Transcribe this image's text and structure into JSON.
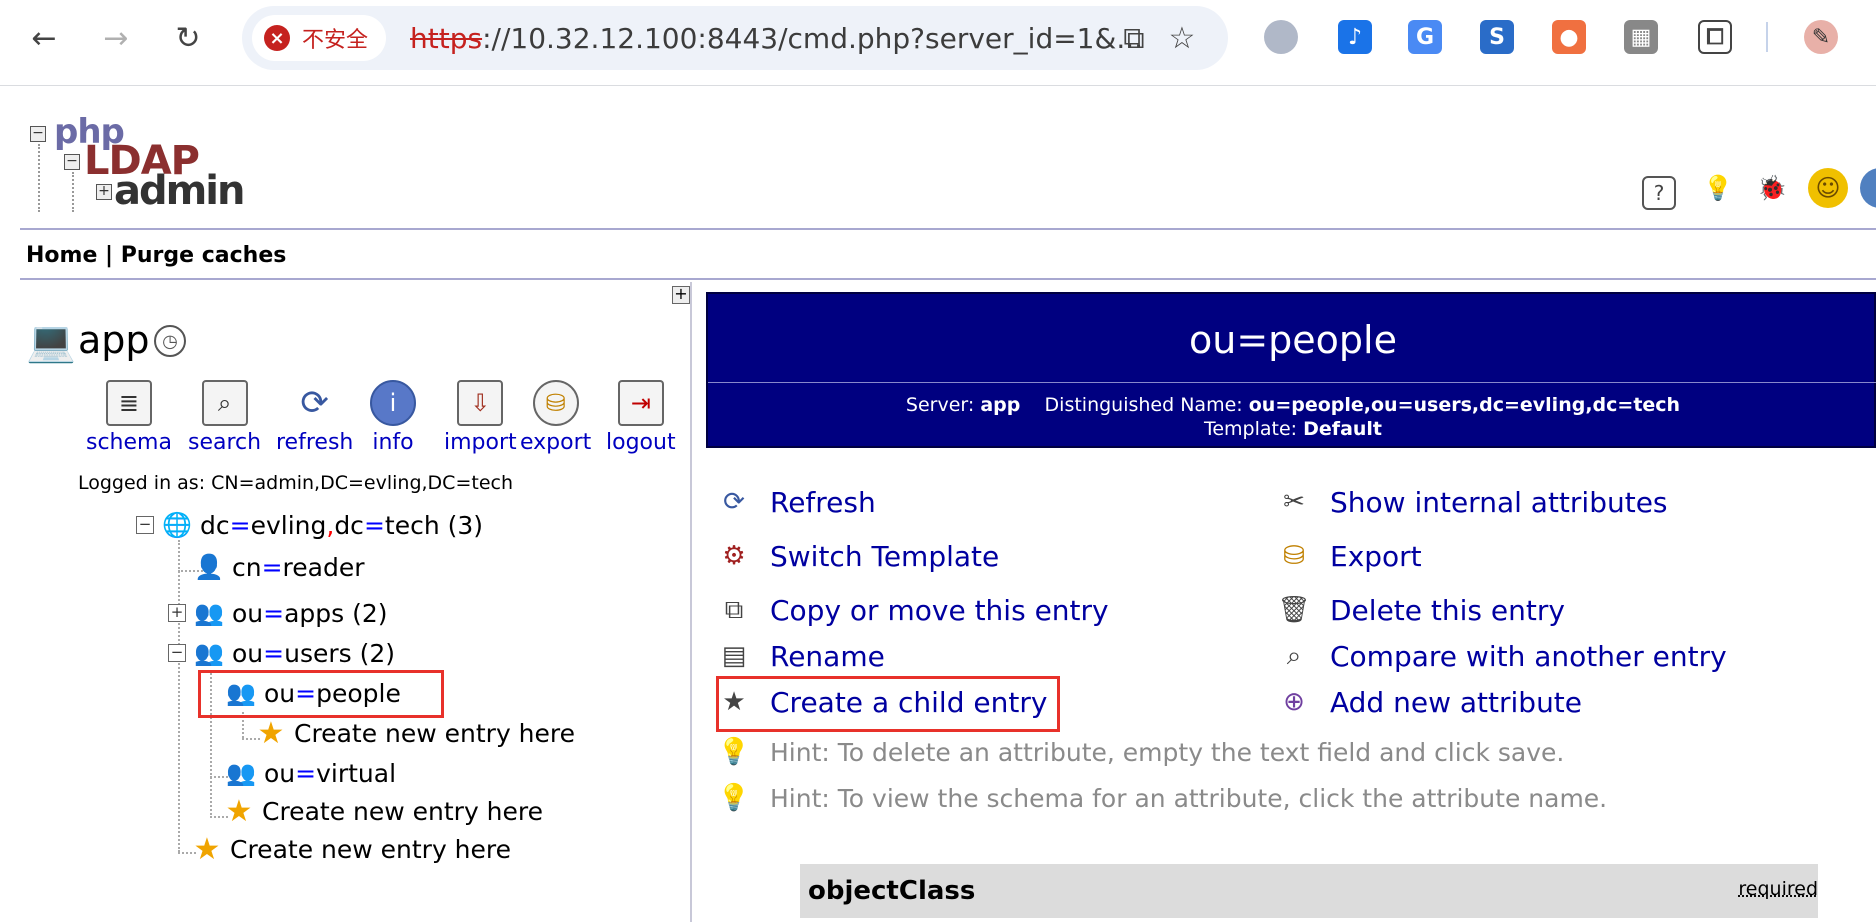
{
  "browser": {
    "security_label": "不安全",
    "url_scheme": "https",
    "url_rest": "://10.32.12.100:8443/cmd.php?server_id=1&..."
  },
  "app": {
    "logo_php": "php",
    "logo_ldap": "LDAP",
    "logo_admin": "admin",
    "menu_home": "Home",
    "menu_sep": "|",
    "menu_purge": "Purge caches"
  },
  "tree": {
    "server_name": "app",
    "tools": [
      "schema",
      "search",
      "refresh",
      "info",
      "import",
      "export",
      "logout"
    ],
    "logged_in": "Logged in as: CN=admin,DC=evling,DC=tech",
    "root": {
      "a": "dc",
      "b": "evling",
      "c": "dc",
      "d": "tech",
      "count": "(3)"
    },
    "reader": {
      "k": "cn",
      "v": "reader"
    },
    "apps": {
      "k": "ou",
      "v": "apps",
      "count": "(2)"
    },
    "users": {
      "k": "ou",
      "v": "users",
      "count": "(2)"
    },
    "people": {
      "k": "ou",
      "v": "people"
    },
    "virtual": {
      "k": "ou",
      "v": "virtual"
    },
    "create_label": "Create new entry here"
  },
  "entry": {
    "title": "ou=people",
    "server_label": "Server:",
    "server_value": "app",
    "dn_label": "Distinguished Name:",
    "dn_value": "ou=people,ou=users,dc=evling,dc=tech",
    "template_label": "Template:",
    "template_value": "Default",
    "actions_left": [
      "Refresh",
      "Switch Template",
      "Copy or move this entry",
      "Rename",
      "Create a child entry"
    ],
    "actions_right": [
      "Show internal attributes",
      "Export",
      "Delete this entry",
      "Compare with another entry",
      "Add new attribute"
    ],
    "hint1": "Hint: To delete an attribute, empty the text field and click save.",
    "hint2": "Hint: To view the schema for an attribute, click the attribute name.",
    "objectclass_label": "objectClass",
    "required_label": "required"
  }
}
